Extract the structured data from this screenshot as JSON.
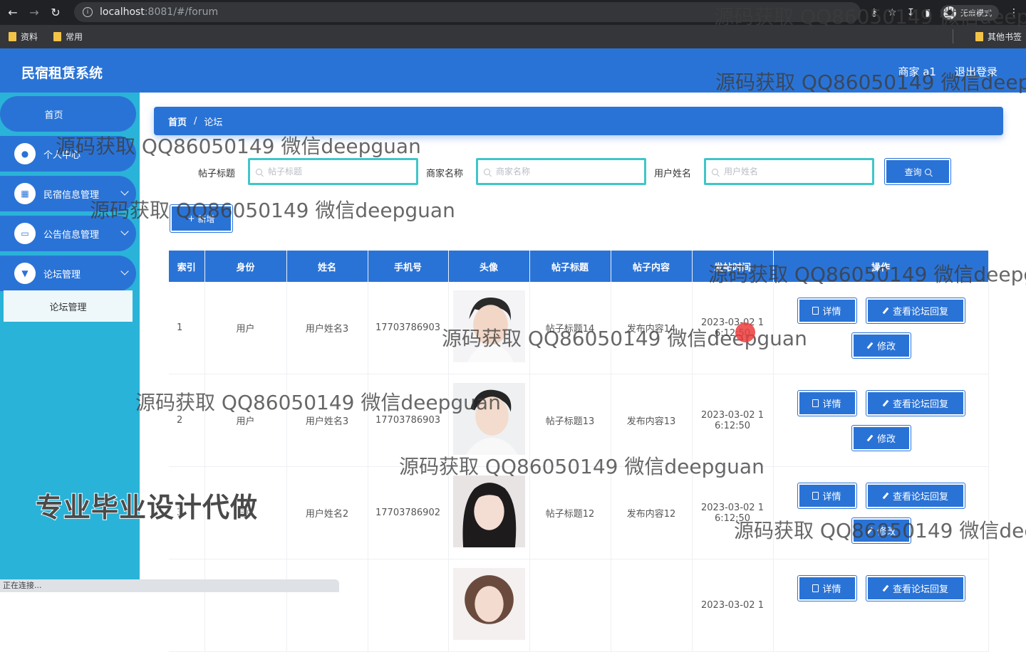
{
  "browser": {
    "url_host": "localhost",
    "url_rest": ":8081/#/forum",
    "incognito_label": "无痕模式",
    "bookmarks": [
      "资料",
      "常用"
    ],
    "other_bookmarks": "其他书签",
    "status": "正在连接..."
  },
  "app": {
    "title": "民宿租赁系统",
    "user": "商家 a1",
    "logout": "退出登录"
  },
  "sidebar": {
    "items": [
      {
        "label": "首页"
      },
      {
        "label": "个人中心"
      },
      {
        "label": "民宿信息管理"
      },
      {
        "label": "公告信息管理"
      },
      {
        "label": "论坛管理"
      }
    ],
    "submenu": "论坛管理"
  },
  "breadcrumb": {
    "home": "首页",
    "sep": "/",
    "current": "论坛"
  },
  "filters": [
    {
      "label": "帖子标题",
      "placeholder": "帖子标题"
    },
    {
      "label": "商家名称",
      "placeholder": "商家名称"
    },
    {
      "label": "用户姓名",
      "placeholder": "用户姓名"
    }
  ],
  "buttons": {
    "search": "查询",
    "add": "新增"
  },
  "table": {
    "headers": [
      "索引",
      "身份",
      "姓名",
      "手机号",
      "头像",
      "帖子标题",
      "帖子内容",
      "发帖时间",
      "操作"
    ],
    "rows": [
      {
        "index": "1",
        "role": "用户",
        "name": "用户姓名3",
        "phone": "17703786903",
        "title": "帖子标题14",
        "content": "发布内容14",
        "time1": "2023-03-02 1",
        "time2": "6:12:50"
      },
      {
        "index": "2",
        "role": "用户",
        "name": "用户姓名3",
        "phone": "17703786903",
        "title": "帖子标题13",
        "content": "发布内容13",
        "time1": "2023-03-02 1",
        "time2": "6:12:50"
      },
      {
        "index": "3",
        "role": "用户",
        "name": "用户姓名2",
        "phone": "17703786902",
        "title": "帖子标题12",
        "content": "发布内容12",
        "time1": "2023-03-02 1",
        "time2": "6:12:50"
      },
      {
        "index": "",
        "role": "",
        "name": "",
        "phone": "",
        "title": "",
        "content": "",
        "time1": "2023-03-02 1",
        "time2": ""
      }
    ],
    "actions": {
      "detail": "详情",
      "reply": "查看论坛回复",
      "edit": "修改"
    }
  },
  "watermarks": {
    "qq": "源码获取 QQ86050149 微信deepguan",
    "promo": "专业毕业设计代做"
  },
  "colors": {
    "primary": "#2a73d6",
    "sidebar": "#2ab3d8",
    "input_border": "#3fc6c8"
  }
}
